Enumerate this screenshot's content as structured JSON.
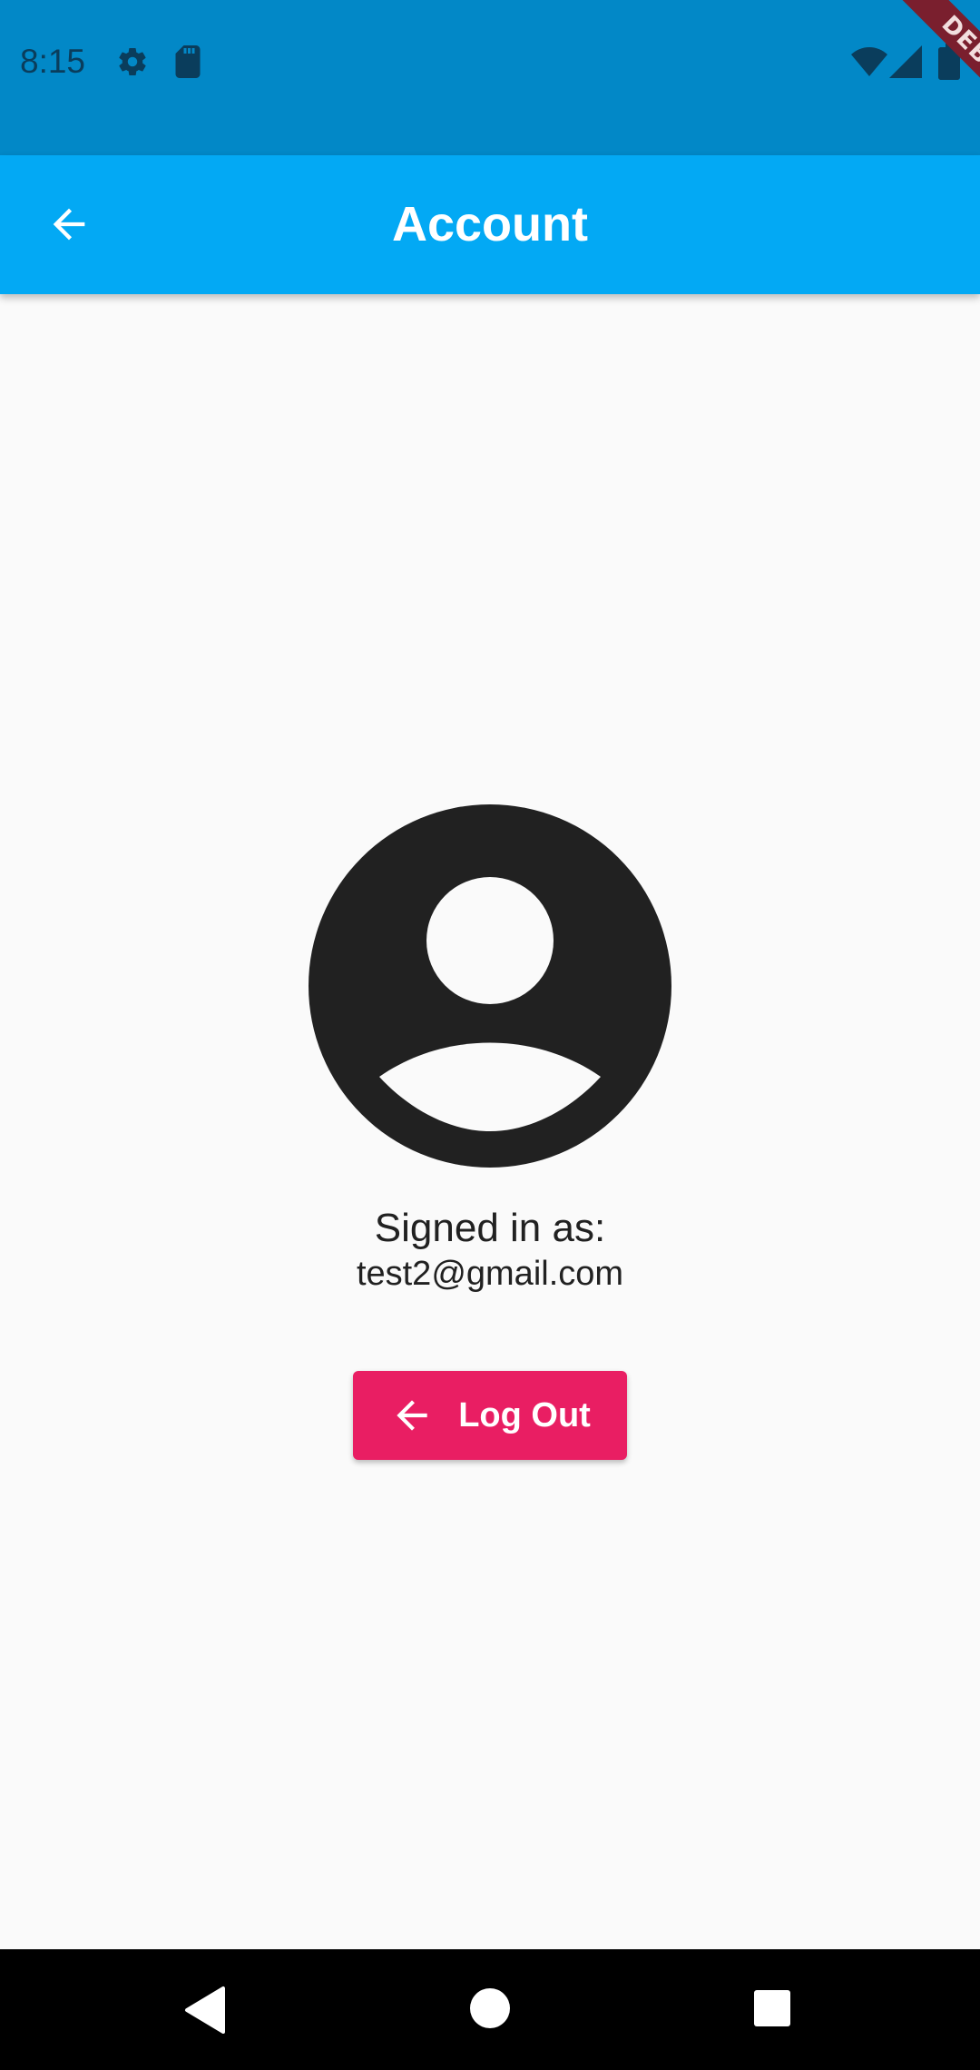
{
  "status_bar": {
    "time": "8:15",
    "icons": [
      "gear-icon",
      "sd-card-icon",
      "wifi-icon",
      "signal-icon",
      "battery-icon"
    ],
    "color": "#0288c7"
  },
  "debug_banner": {
    "label": "DEBUG"
  },
  "app_bar": {
    "title": "Account",
    "back_icon": "arrow-left-icon",
    "color": "#03a9f4"
  },
  "account": {
    "avatar_icon": "account-circle-icon",
    "signed_in_label": "Signed in as:",
    "email": "test2@gmail.com"
  },
  "logout_button": {
    "label": "Log Out",
    "icon": "arrow-left-icon",
    "color": "#e91e63"
  },
  "nav_bar": {
    "buttons": [
      "back-triangle-icon",
      "home-circle-icon",
      "recents-square-icon"
    ]
  }
}
